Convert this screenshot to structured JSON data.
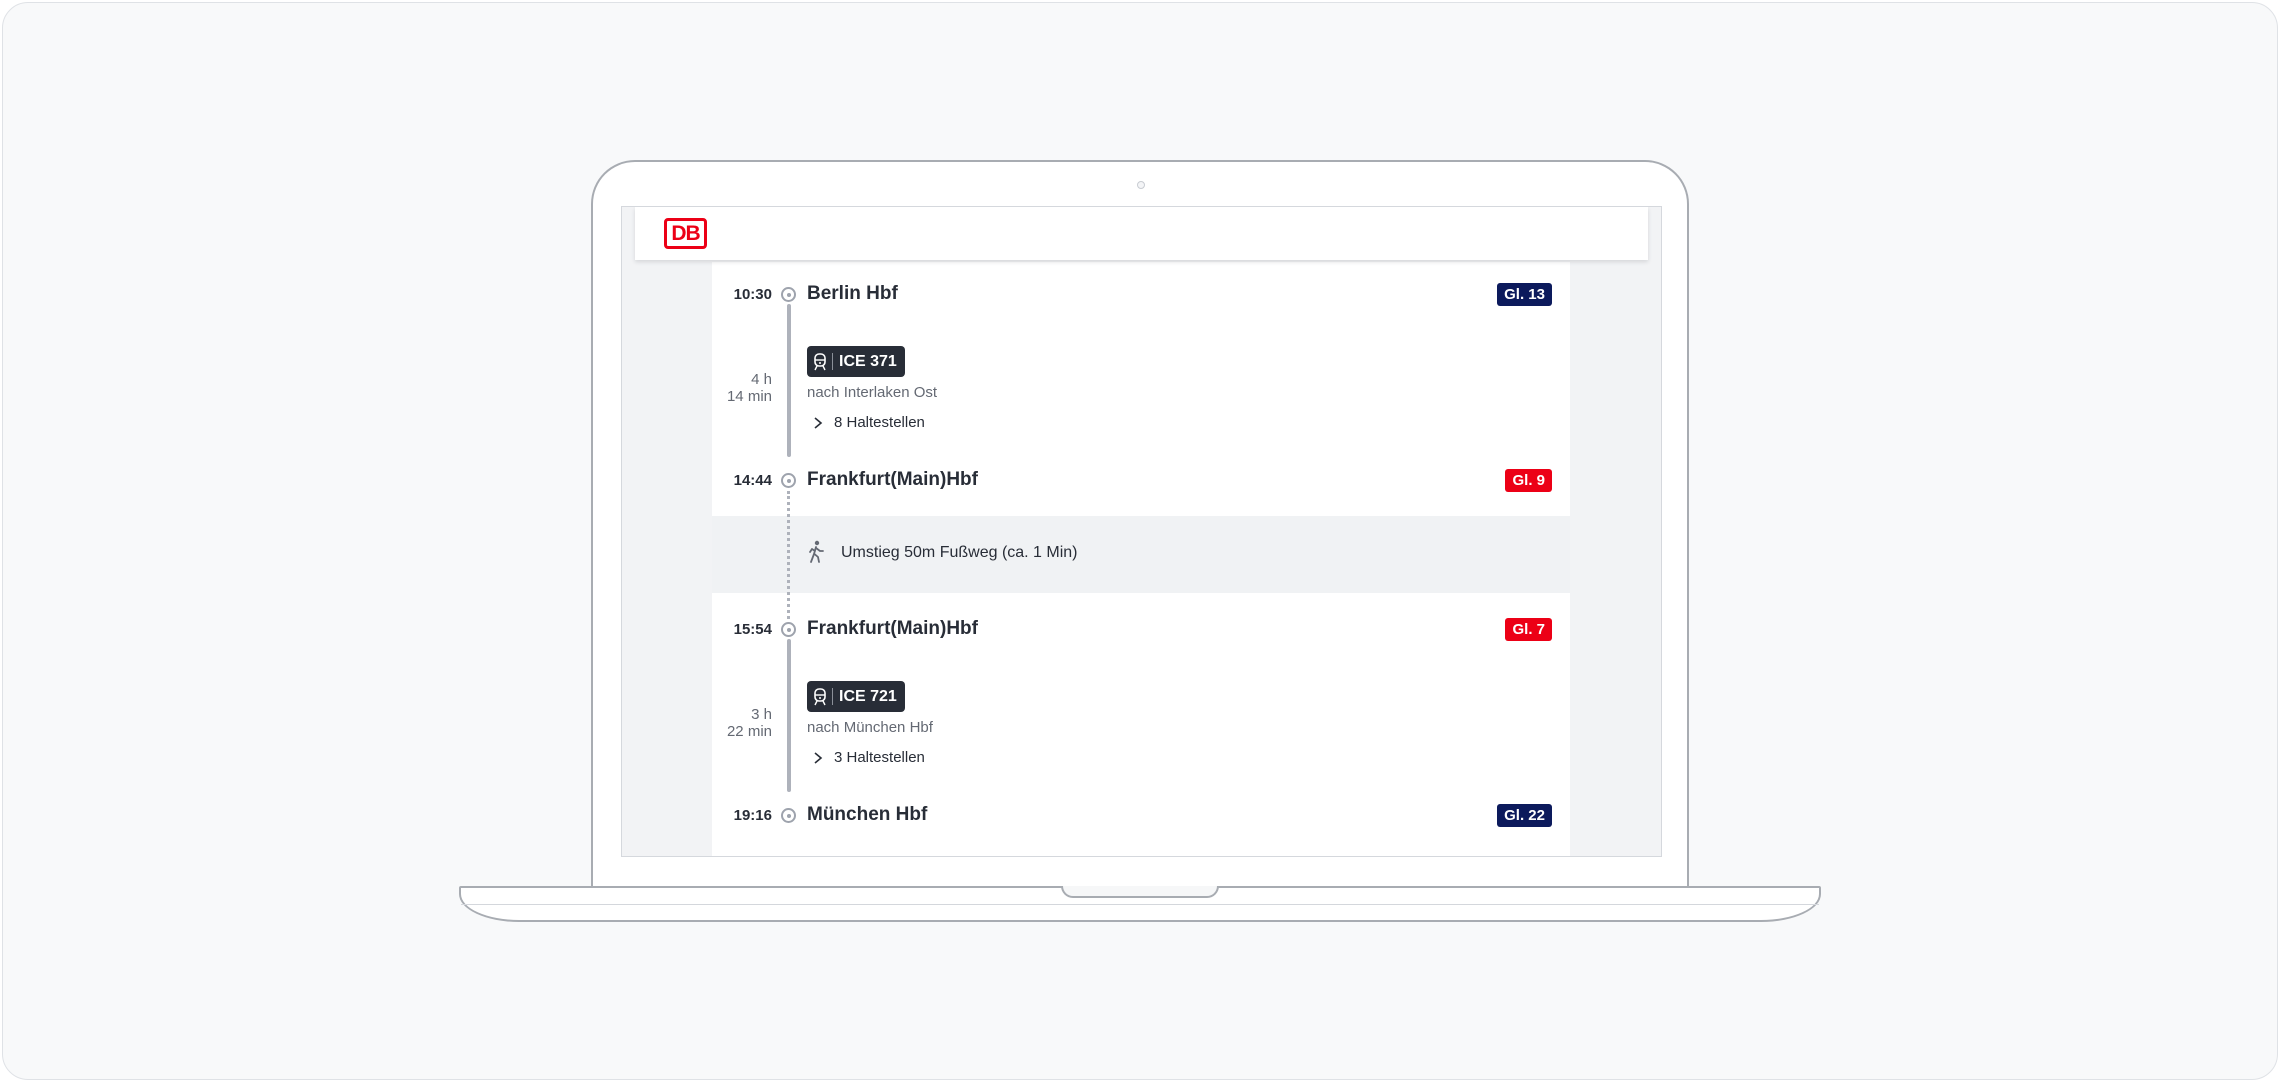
{
  "app": {
    "logo_text": "DB",
    "brand_color": "#ec0016"
  },
  "journey": {
    "legs": [
      {
        "departure": {
          "time": "10:30",
          "station": "Berlin Hbf",
          "platform": "Gl. 13",
          "platform_color": "#0c1a5c"
        },
        "duration_hours": "4 h",
        "duration_minutes": "14 min",
        "train": {
          "icon": "train-icon",
          "name": "ICE 371"
        },
        "direction": "nach Interlaken Ost",
        "stops_label": "8 Haltestellen",
        "arrival": {
          "time": "14:44",
          "station": "Frankfurt(Main)Hbf",
          "platform": "Gl. 9",
          "platform_color": "#ec0016"
        }
      },
      {
        "departure": {
          "time": "15:54",
          "station": "Frankfurt(Main)Hbf",
          "platform": "Gl. 7",
          "platform_color": "#ec0016"
        },
        "duration_hours": "3 h",
        "duration_minutes": "22 min",
        "train": {
          "icon": "train-icon",
          "name": "ICE 721"
        },
        "direction": "nach München Hbf",
        "stops_label": "3 Haltestellen",
        "arrival": {
          "time": "19:16",
          "station": "München Hbf",
          "platform": "Gl. 22",
          "platform_color": "#0c1a5c"
        }
      }
    ],
    "transfer": {
      "icon": "walking-icon",
      "text": "Umstieg 50m Fußweg (ca. 1 Min)"
    }
  }
}
